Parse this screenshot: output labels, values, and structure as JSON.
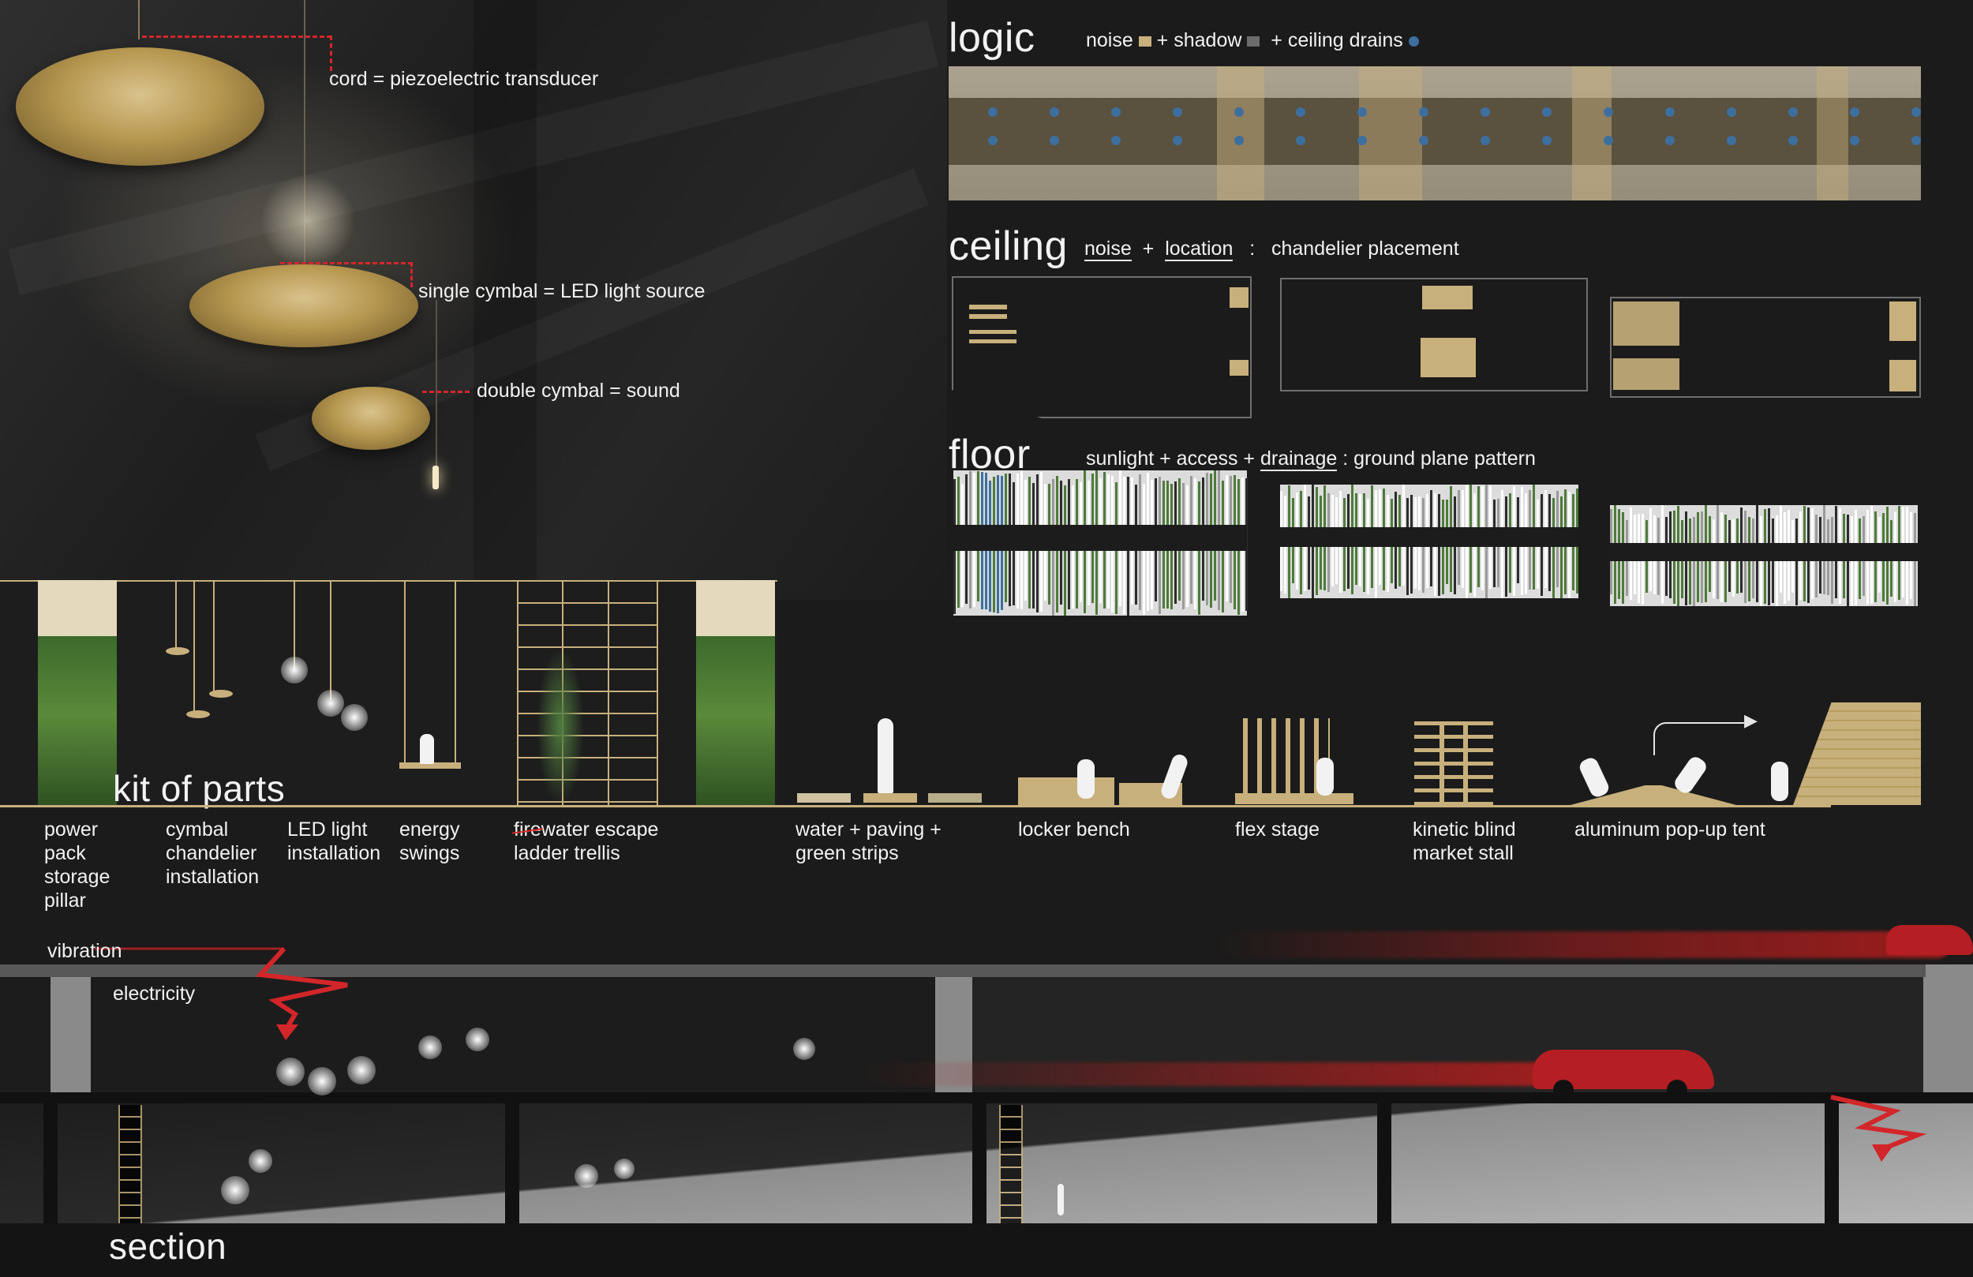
{
  "cymbal_labels": {
    "cord": "cord = piezoelectric transducer",
    "single": "single cymbal = LED light source",
    "double": "double cymbal = sound"
  },
  "logic": {
    "title": "logic",
    "legend_noise": "noise",
    "legend_plus1": "+",
    "legend_shadow": "shadow",
    "legend_plus2": "+",
    "legend_drains": "ceiling drains"
  },
  "ceiling": {
    "title": "ceiling",
    "noise": "noise",
    "plus": "+",
    "location": "location",
    "colon": ":",
    "result": "chandelier placement"
  },
  "floor": {
    "title": "floor",
    "formula": "sunlight  +  access  +",
    "drainage": "drainage",
    "result": ":  ground plane pattern"
  },
  "kit": {
    "title": "kit of parts",
    "items": [
      "power pack storage pillar",
      "cymbal chandelier installation",
      "LED light installation",
      "energy swings",
      "ladder trellis",
      "water  +  paving + green strips",
      "locker bench",
      "flex stage",
      "kinetic blind market stall",
      "aluminum pop-up tent"
    ],
    "struck_word": "fire",
    "escape_word": "water escape"
  },
  "section": {
    "title": "section",
    "vibration": "vibration",
    "electricity": "electricity"
  },
  "colors": {
    "tan": "#c8b07c",
    "red": "#d3262a",
    "drain_blue": "#3d6f9e",
    "green": "#4e7a3a",
    "background": "#1b1b1b"
  }
}
